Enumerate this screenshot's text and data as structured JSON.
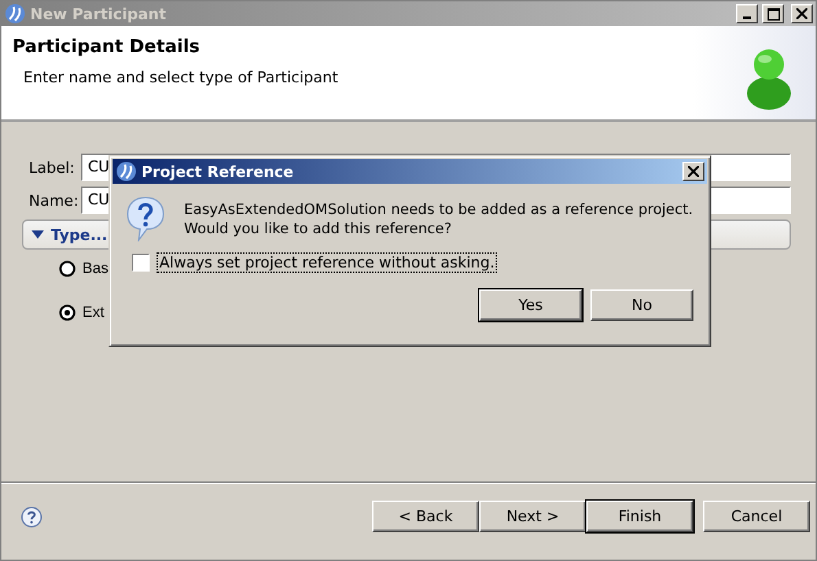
{
  "window": {
    "title": "New Participant"
  },
  "header": {
    "title": "Participant Details",
    "subtitle": "Enter name and select type of Participant"
  },
  "fields": [
    {
      "label": "Label:",
      "value": "CU"
    },
    {
      "label": "Name:",
      "value": "CU"
    }
  ],
  "section": {
    "title": "Type...",
    "expanded": true
  },
  "radios": [
    {
      "label": "Bas",
      "selected": false
    },
    {
      "label": "Ext",
      "selected": true
    }
  ],
  "buttons": [
    {
      "label": "< Back",
      "default": false
    },
    {
      "label": "Next >",
      "default": false
    },
    {
      "label": "Finish",
      "default": true
    },
    {
      "label": "Cancel",
      "default": false
    }
  ],
  "dialog": {
    "title": "Project Reference",
    "message": [
      "EasyAsExtendedOMSolution needs to be added as a reference project.",
      "Would you like to add this reference?"
    ],
    "checkbox": {
      "label": "Always set project reference without asking.",
      "checked": false
    },
    "buttons": [
      {
        "label": "Yes",
        "default": true
      },
      {
        "label": "No",
        "default": false
      }
    ]
  }
}
